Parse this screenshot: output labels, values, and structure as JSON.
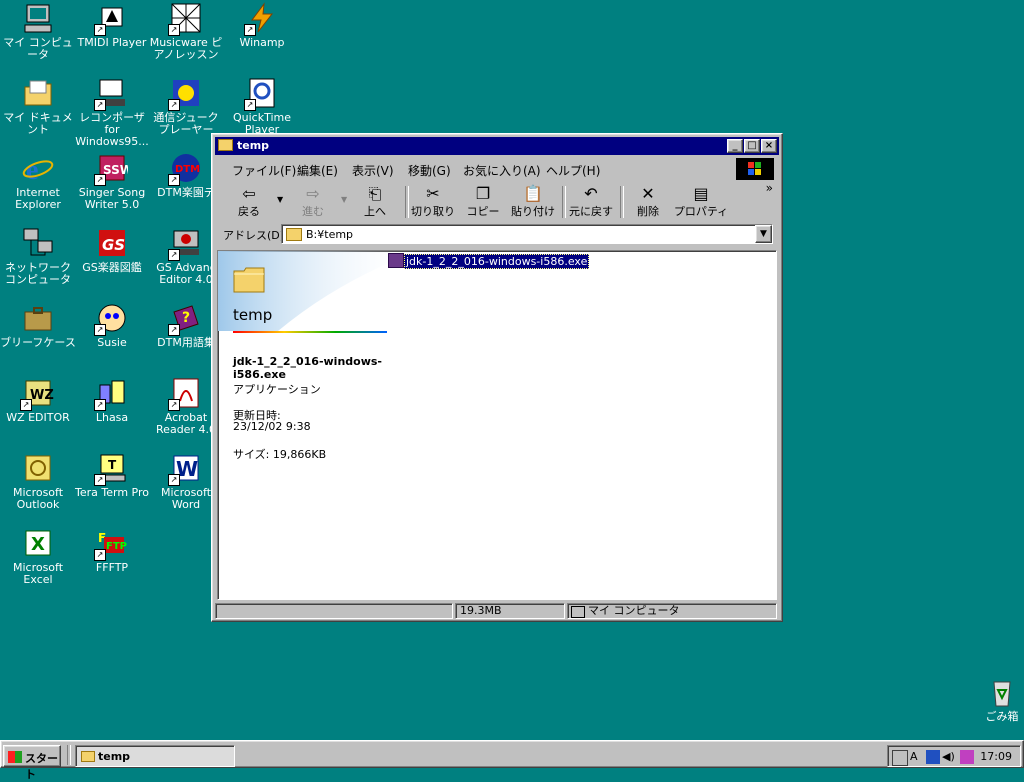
{
  "desktop": {
    "icons": [
      {
        "label": "マイ コンピュータ",
        "icon": "my-computer-icon"
      },
      {
        "label": "TMIDI Player",
        "icon": "tmidi-player-icon"
      },
      {
        "label": "Musicware ピアノレッスン",
        "icon": "musicware-piano-icon"
      },
      {
        "label": "Winamp",
        "icon": "winamp-icon"
      },
      {
        "label": "マイ ドキュメント",
        "icon": "my-documents-icon"
      },
      {
        "label": "レコンポーザ for Windows95...",
        "icon": "recomposer-icon"
      },
      {
        "label": "通信ジューク プレーヤー",
        "icon": "tsushin-juke-icon"
      },
      {
        "label": "QuickTime Player",
        "icon": "quicktime-icon"
      },
      {
        "label": "Internet Explorer",
        "icon": "internet-explorer-icon"
      },
      {
        "label": "Singer Song Writer 5.0",
        "icon": "singer-song-writer-icon"
      },
      {
        "label": "DTM楽園デ",
        "icon": "dtm-rakuen-icon"
      },
      {
        "label": "ネットワーク コンピュータ",
        "icon": "network-computer-icon"
      },
      {
        "label": "GS楽器図鑑",
        "icon": "gs-instrument-icon"
      },
      {
        "label": "GS Advanc Editor 4.0",
        "icon": "gs-advanced-editor-icon"
      },
      {
        "label": "ブリーフケース",
        "icon": "briefcase-icon"
      },
      {
        "label": "Susie",
        "icon": "susie-icon"
      },
      {
        "label": "DTM用語集",
        "icon": "dtm-glossary-icon"
      },
      {
        "label": "WZ EDITOR",
        "icon": "wz-editor-icon"
      },
      {
        "label": "Lhasa",
        "icon": "lhasa-icon"
      },
      {
        "label": "Acrobat Reader 4.0",
        "icon": "acrobat-reader-icon"
      },
      {
        "label": "Microsoft Outlook",
        "icon": "outlook-icon"
      },
      {
        "label": "Tera Term Pro",
        "icon": "tera-term-icon"
      },
      {
        "label": "Microsoft Word",
        "icon": "word-icon"
      },
      {
        "label": "Microsoft Excel",
        "icon": "excel-icon"
      },
      {
        "label": "FFFTP",
        "icon": "ffftp-icon"
      }
    ],
    "recycle_label": "ごみ箱"
  },
  "window": {
    "title": "temp",
    "menu": [
      "ファイル(F)",
      "編集(E)",
      "表示(V)",
      "移動(G)",
      "お気に入り(A)",
      "ヘルプ(H)"
    ],
    "toolbar": {
      "back": "戻る",
      "forward": "進む",
      "up": "上へ",
      "cut": "切り取り",
      "copy": "コピー",
      "paste": "貼り付け",
      "undo": "元に戻す",
      "delete": "削除",
      "properties": "プロパティ",
      "more": "»"
    },
    "address": {
      "label": "アドレス(D)",
      "value": "B:¥temp"
    },
    "webview": {
      "folder_title": "temp",
      "file_name": "jdk-1_2_2_016-windows-i586.exe",
      "file_type": "アプリケーション",
      "modified_label": "更新日時:",
      "modified_value": "23/12/02 9:38",
      "size": "サイズ: 19,866KB"
    },
    "file_item": "jdk-1_2_2_016-windows-i586.exe",
    "status": {
      "size": "19.3MB",
      "zone": "マイ コンピュータ"
    }
  },
  "taskbar": {
    "start_label": "スタート",
    "task_label": "temp",
    "clock": "17:09"
  }
}
